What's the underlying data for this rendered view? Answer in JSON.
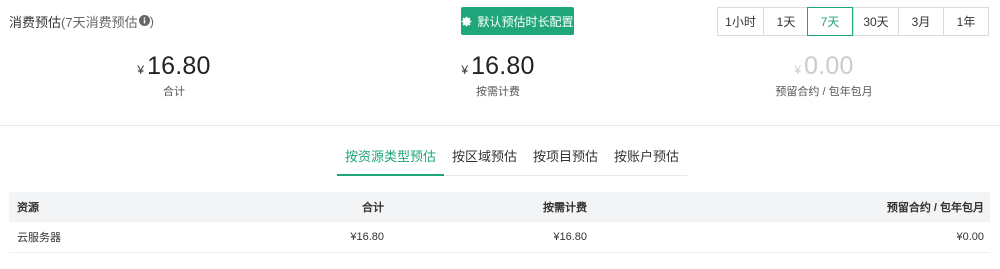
{
  "header": {
    "title_main": "消费预估",
    "title_sub": "(7天消费预估",
    "config_button": "默认预估时长配置",
    "ranges": [
      "1小时",
      "1天",
      "7天",
      "30天",
      "3月",
      "1年"
    ],
    "active_range": "7天"
  },
  "summary": [
    {
      "currency": "¥",
      "value": "16.80",
      "label": "合计"
    },
    {
      "currency": "¥",
      "value": "16.80",
      "label": "按需计费"
    },
    {
      "currency": "¥",
      "value": "0.00",
      "label": "预留合约 / 包年包月"
    }
  ],
  "tabs": [
    "按资源类型预估",
    "按区域预估",
    "按项目预估",
    "按账户预估"
  ],
  "active_tab": "按资源类型预估",
  "table": {
    "headers": [
      "资源",
      "合计",
      "按需计费",
      "预留合约 / 包年包月"
    ],
    "rows": [
      [
        "云服务器",
        "¥16.80",
        "¥16.80",
        "¥0.00"
      ]
    ]
  },
  "colors": {
    "accent": "#1fa67a",
    "muted": "#c8ccd0"
  },
  "icons": {
    "info": "info-icon",
    "config": "gear-icon"
  }
}
